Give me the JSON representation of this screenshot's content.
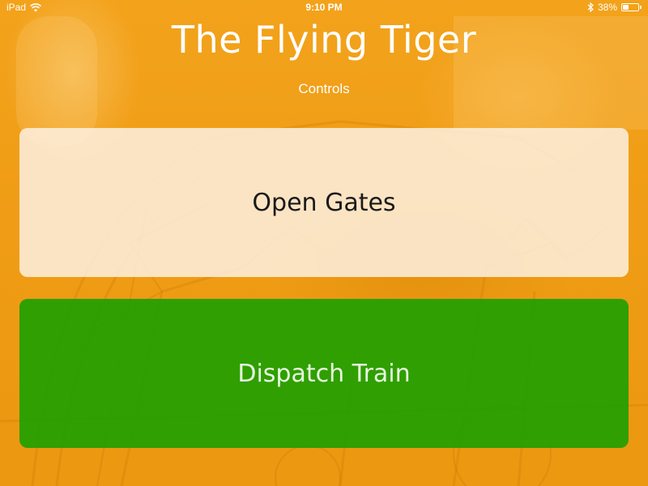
{
  "status_bar": {
    "device": "iPad",
    "time": "9:10 PM",
    "battery_percent": "38%",
    "battery_level": 0.38
  },
  "header": {
    "title": "The Flying Tiger",
    "subtitle": "Controls"
  },
  "buttons": {
    "open_gates": "Open Gates",
    "dispatch_train": "Dispatch Train"
  },
  "colors": {
    "background_tint": "#f0a21c",
    "open_gates_bg": "#fdf0e0",
    "dispatch_bg": "#1ea000",
    "dispatch_text": "#e8f5e0"
  },
  "icons": {
    "wifi": "wifi-icon",
    "bluetooth": "bluetooth-icon",
    "battery": "battery-icon"
  }
}
